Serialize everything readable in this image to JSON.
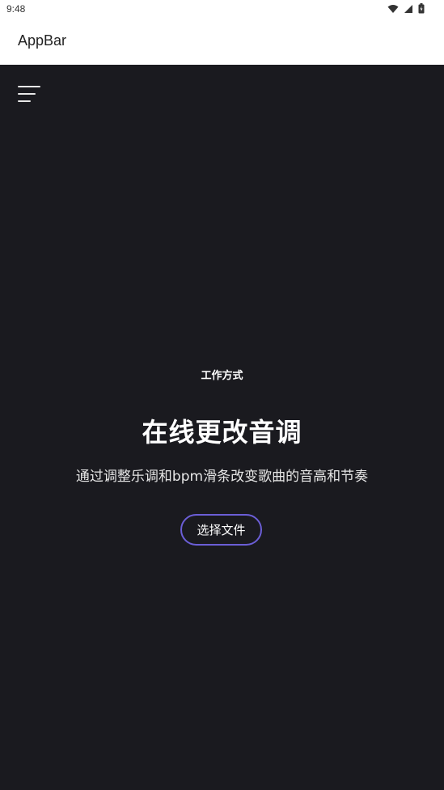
{
  "status_bar": {
    "time": "9:48",
    "icons": [
      "wifi-icon",
      "signal-icon",
      "battery-icon"
    ]
  },
  "app_bar": {
    "title": "AppBar"
  },
  "menu": {
    "icon": "menu-icon"
  },
  "hero": {
    "section_label": "工作方式",
    "headline": "在线更改音调",
    "subtitle": "通过调整乐调和bpm滑条改变歌曲的音高和节奏",
    "button_label": "选择文件"
  },
  "colors": {
    "background": "#1a1a1f",
    "accent": "#6b5ed6",
    "text": "#ffffff"
  }
}
